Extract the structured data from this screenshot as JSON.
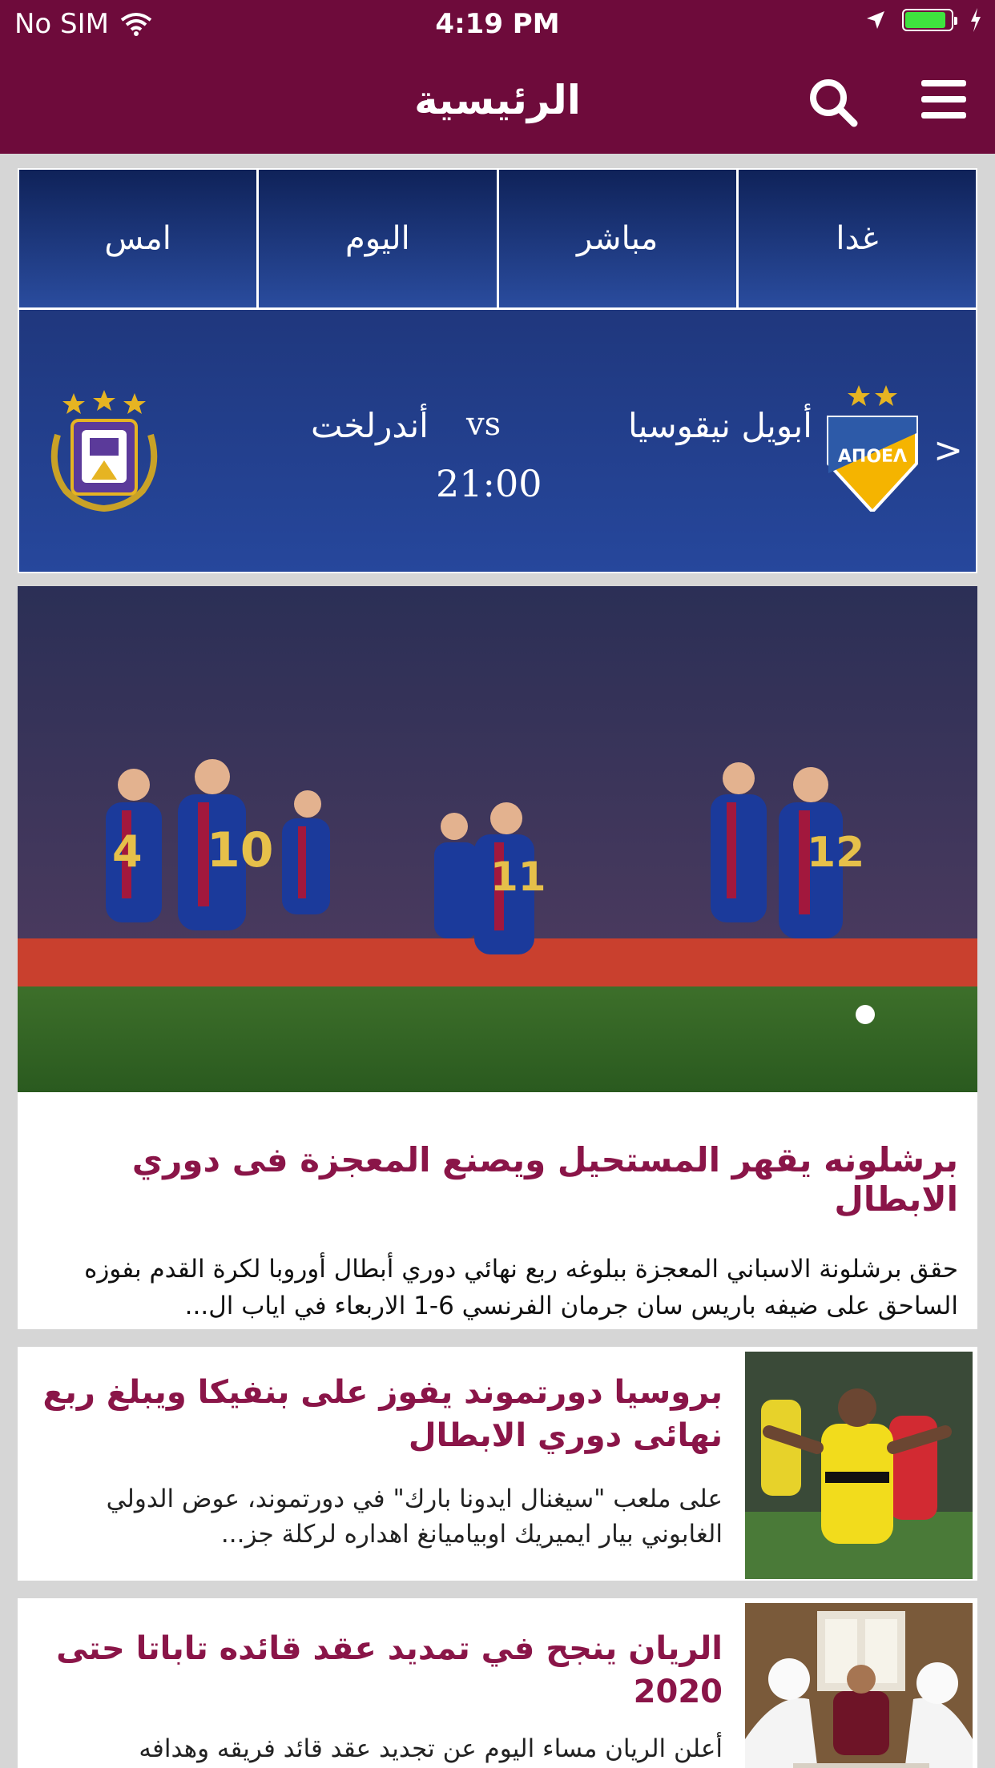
{
  "status_bar": {
    "carrier": "No SIM",
    "time": "4:19 PM",
    "battery_level": 0.9
  },
  "nav": {
    "title": "الرئيسية"
  },
  "matches": {
    "tabs": [
      "امس",
      "اليوم",
      "مباشر",
      "غدا"
    ],
    "match": {
      "home_team": "أبويل نيقوسيا",
      "vs": "vs",
      "away_team": "أندرلخت",
      "time": "21:00",
      "arrow": ">"
    }
  },
  "featured": {
    "title": "برشلونه يقهر المستحيل ويصنع المعجزة فى دوري الابطال",
    "summary": "حقق برشلونة الاسباني المعجزة ببلوغه ربع نهائي دوري أبطال أوروبا لكرة القدم بفوزه الساحق على ضيفه باريس سان جرمان الفرنسي 6-1 الاربعاء في اياب ال..."
  },
  "news": [
    {
      "title": "بروسيا دورتموند يفوز على بنفيكا ويبلغ ربع نهائى دوري الابطال",
      "summary": "على ملعب \"سيغنال ايدونا بارك\" في دورتموند، عوض الدولي الغابوني بيار ايميريك اوبياميانغ اهداره لركلة جز..."
    },
    {
      "title": "الريان ينجح في تمديد عقد قائده تاباتا حتى 2020",
      "summary": "أعلن الريان مساء اليوم عن تجديد عقد قائد فريقه وهدافه"
    }
  ]
}
